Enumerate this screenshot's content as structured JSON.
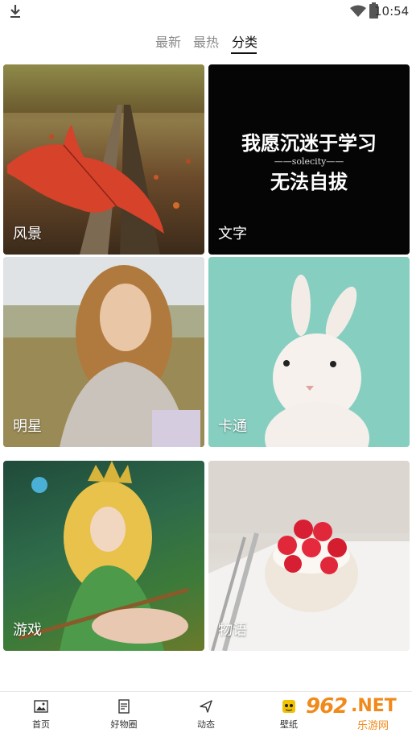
{
  "status_bar": {
    "time": "10:54",
    "download_icon": "download-icon",
    "wifi_icon": "wifi-icon",
    "battery_icon": "battery-icon"
  },
  "tabs": [
    {
      "label": "最新",
      "active": false
    },
    {
      "label": "最热",
      "active": false
    },
    {
      "label": "分类",
      "active": true
    }
  ],
  "categories": [
    {
      "label": "风景"
    },
    {
      "label": "文字",
      "overlay": {
        "line1": "我愿沉迷于学习",
        "line2": "——solecity——",
        "line3": "无法自拔"
      }
    },
    {
      "label": "明星"
    },
    {
      "label": "卡通"
    },
    {
      "label": "游戏"
    },
    {
      "label": "物语"
    }
  ],
  "bottom_nav": [
    {
      "label": "首页",
      "icon": "image-icon"
    },
    {
      "label": "好物圈",
      "icon": "document-icon"
    },
    {
      "label": "动态",
      "icon": "send-icon"
    },
    {
      "label": "壁纸",
      "icon": "face-icon"
    },
    {
      "label": "",
      "icon": ""
    }
  ],
  "watermark": {
    "number": "962",
    "suffix": ".NET",
    "site": "乐游网"
  },
  "colors": {
    "accent": "#111111",
    "watermark": "#f08a1c"
  }
}
